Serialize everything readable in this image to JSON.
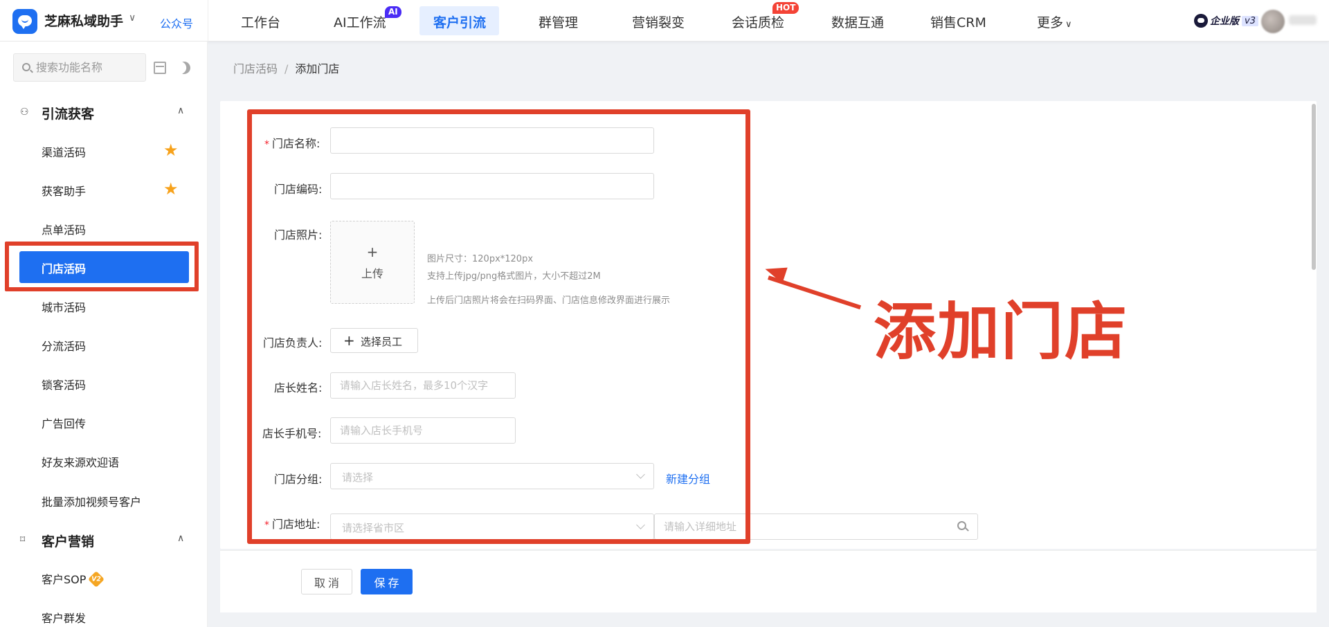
{
  "header": {
    "app_name": "芝麻私域助手",
    "account_link": "公众号",
    "nav": [
      {
        "label": "工作台"
      },
      {
        "label": "AI工作流",
        "badge": "AI"
      },
      {
        "label": "客户引流",
        "active": true
      },
      {
        "label": "群管理"
      },
      {
        "label": "营销裂变"
      },
      {
        "label": "会话质检",
        "badge": "HOT"
      },
      {
        "label": "数据互通"
      },
      {
        "label": "销售CRM"
      },
      {
        "label": "更多"
      }
    ],
    "edition": "企业版",
    "version": "v3"
  },
  "sidebar": {
    "search_placeholder": "搜索功能名称",
    "sections": [
      {
        "title": "引流获客",
        "items": [
          {
            "label": "渠道活码",
            "starred": true
          },
          {
            "label": "获客助手",
            "starred": true
          },
          {
            "label": "点单活码"
          },
          {
            "label": "门店活码",
            "active": true
          },
          {
            "label": "城市活码"
          },
          {
            "label": "分流活码"
          },
          {
            "label": "锁客活码"
          },
          {
            "label": "广告回传"
          },
          {
            "label": "好友来源欢迎语"
          },
          {
            "label": "批量添加视频号客户"
          }
        ]
      },
      {
        "title": "客户营销",
        "items": [
          {
            "label": "客户SOP",
            "badge": "V2"
          },
          {
            "label": "客户群发"
          }
        ]
      }
    ]
  },
  "breadcrumb": {
    "parent": "门店活码",
    "separator": "/",
    "current": "添加门店"
  },
  "form": {
    "store_name": {
      "label": "门店名称:",
      "required": true,
      "value": ""
    },
    "store_code": {
      "label": "门店编码:",
      "value": ""
    },
    "store_photo": {
      "label": "门店照片:",
      "upload_label": "上传",
      "hint_size": "图片尺寸：120px*120px",
      "hint_format": "支持上传jpg/png格式图片，大小不超过2M",
      "hint_display": "上传后门店照片将会在扫码界面、门店信息修改界面进行展示"
    },
    "store_manager": {
      "label": "门店负责人:",
      "button": "选择员工"
    },
    "owner_name": {
      "label": "店长姓名:",
      "placeholder": "请输入店长姓名，最多10个汉字"
    },
    "owner_phone": {
      "label": "店长手机号:",
      "placeholder": "请输入店长手机号"
    },
    "store_group": {
      "label": "门店分组:",
      "placeholder": "请选择",
      "new_group_link": "新建分组"
    },
    "store_address": {
      "label": "门店地址:",
      "required": true,
      "region_placeholder": "请选择省市区",
      "detail_placeholder": "请输入详细地址"
    }
  },
  "actions": {
    "cancel": "取消",
    "save": "保存"
  },
  "annotation": {
    "text": "添加门店",
    "color": "#e0402a"
  },
  "colors": {
    "primary": "#1e6ff1",
    "highlight": "#e0402a",
    "star": "#f7a21b"
  }
}
